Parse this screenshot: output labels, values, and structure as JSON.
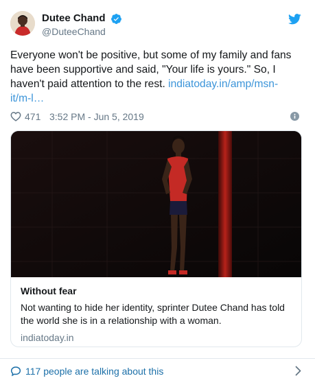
{
  "author": {
    "display_name": "Dutee Chand",
    "handle": "@DuteeChand",
    "verified": true,
    "avatar_icon": "avatar-photo"
  },
  "tweet": {
    "text": "Everyone won't be positive, but some of my family and fans have been supportive and said, \"Your life is yours.\" So, I haven't paid attention to the rest. ",
    "link": "indiatoday.in/amp/msn-it/m-l…",
    "likes": "471",
    "timestamp": "3:52 PM - Jun 5, 2019"
  },
  "card": {
    "title": "Without fear",
    "description": "Not wanting to hide her identity, sprinter Dutee Chand has told the world she is in a relationship with a woman.",
    "domain": "indiatoday.in"
  },
  "footer": {
    "talking": "117 people are talking about this"
  },
  "colors": {
    "link": "#3b94d9",
    "twitter_blue": "#1da1f2",
    "muted": "#657786",
    "heart": "#657786"
  },
  "icons": {
    "brand": "twitter-bird-icon",
    "verified": "verified-badge-icon",
    "like": "heart-icon",
    "info": "info-icon",
    "reply": "speech-bubble-icon",
    "more": "chevron-right-icon"
  }
}
